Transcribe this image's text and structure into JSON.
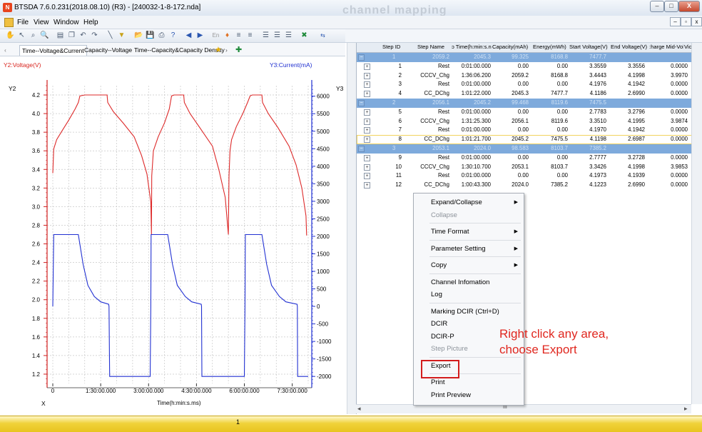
{
  "window": {
    "title": "BTSDA 7.6.0.231(2018.08.10) (R3) - [240032-1-8-172.nda]",
    "background_text": "channel mapping",
    "app_icon": "N"
  },
  "window_controls": {
    "minimize": "–",
    "maximize": "□",
    "close": "X"
  },
  "mdi_controls": {
    "minimize": "–",
    "restore": "▫",
    "close": "x"
  },
  "menu": [
    "File",
    "View",
    "Window",
    "Help"
  ],
  "toolbar_icons": [
    "hand-icon",
    "pointer-icon",
    "zoom-region-icon",
    "zoom-icon",
    "table-icon",
    "copy-icon",
    "undo-icon",
    "redo-icon",
    "line-icon",
    "filter-icon",
    "open-icon",
    "save-icon",
    "print-icon",
    "help-icon",
    "prev-icon",
    "next-icon",
    "en-icon",
    "pin-icon",
    "grid-icon",
    "grid2-icon",
    "list-icon",
    "list2-icon",
    "list3-icon",
    "excel-icon",
    "export-icon"
  ],
  "tabs": [
    "Time--Voltage&Current",
    "Capacity--Voltage",
    "Time--Capacity&Capacity Density"
  ],
  "chart": {
    "y2_legend": "Y2:Voltage(V)",
    "y3_legend": "Y3:Current(mA)",
    "y2_axis_title": "Y2",
    "y3_axis_title": "Y3",
    "x_axis_title": "X",
    "x_label": "Time(h:min:s.ms)",
    "y2_ticks": [
      "4.2",
      "4.0",
      "3.8",
      "3.6",
      "3.4",
      "3.2",
      "3.0",
      "2.8",
      "2.6",
      "2.4",
      "2.2",
      "2.0",
      "1.8",
      "1.6",
      "1.4",
      "1.2"
    ],
    "y3_ticks": [
      "6000",
      "5500",
      "5000",
      "4500",
      "4000",
      "3500",
      "3000",
      "2500",
      "2000",
      "1500",
      "1000",
      "500",
      "0",
      "-500",
      "-1000",
      "-1500",
      "-2000"
    ],
    "x_ticks": [
      "0",
      "1:30:00.000",
      "3:00:00.000",
      "4:30:00.000",
      "6:00:00.000",
      "7:30:00.000"
    ]
  },
  "chart_data": {
    "type": "line",
    "title": "",
    "xlabel": "Time(h:min:s.ms)",
    "x_unit_note": "hours",
    "xlim": [
      0,
      8
    ],
    "series": [
      {
        "name": "Y2:Voltage(V)",
        "axis": "left",
        "color": "#dd2a2a",
        "ylim": [
          1.1,
          4.3
        ],
        "x": [
          0,
          0.03,
          0.12,
          0.3,
          0.5,
          0.7,
          0.8,
          0.85,
          1.0,
          1.55,
          1.7,
          1.72,
          1.9,
          2.2,
          2.55,
          2.78,
          2.95,
          3.07,
          3.09,
          3.1,
          3.15,
          3.3,
          3.5,
          3.65,
          3.72,
          3.8,
          4.0,
          4.1,
          4.12,
          4.3,
          4.6,
          5.0,
          5.2,
          5.4,
          5.5,
          5.52,
          5.55,
          5.6,
          5.75,
          5.95,
          6.1,
          6.18,
          6.25,
          6.45,
          6.55,
          6.57,
          6.75,
          7.05,
          7.4,
          7.62,
          7.8,
          7.93,
          7.95
        ],
        "values": [
          3.36,
          3.62,
          3.72,
          3.82,
          3.93,
          4.05,
          4.12,
          4.19,
          4.2,
          4.2,
          4.2,
          4.12,
          4.02,
          3.9,
          3.75,
          3.55,
          3.35,
          3.05,
          2.7,
          3.33,
          3.6,
          3.75,
          3.9,
          4.05,
          4.19,
          4.2,
          4.2,
          4.2,
          4.12,
          4.0,
          3.85,
          3.65,
          3.4,
          3.1,
          2.7,
          3.33,
          3.6,
          3.72,
          3.86,
          4.0,
          4.12,
          4.19,
          4.2,
          4.2,
          4.2,
          4.12,
          4.0,
          3.85,
          3.65,
          3.45,
          3.2,
          2.9,
          2.69
        ]
      },
      {
        "name": "Y3:Current(mA)",
        "axis": "right",
        "color": "#2231d2",
        "ylim": [
          -2200,
          6300
        ],
        "x": [
          0,
          0.03,
          0.8,
          0.95,
          1.1,
          1.3,
          1.5,
          1.75,
          1.76,
          1.78,
          3.05,
          3.07,
          3.08,
          3.15,
          3.6,
          3.75,
          3.9,
          4.15,
          4.35,
          4.65,
          4.66,
          4.67,
          6.0,
          6.02,
          6.03,
          6.1,
          6.55,
          6.7,
          6.85,
          7.1,
          7.3,
          7.65,
          7.66,
          7.67,
          8.0
        ],
        "values": [
          0,
          2050,
          2050,
          1200,
          600,
          280,
          130,
          60,
          0,
          -2000,
          -2000,
          0,
          2050,
          2050,
          2050,
          1200,
          600,
          280,
          130,
          60,
          0,
          -2000,
          -2000,
          0,
          2050,
          2050,
          2050,
          1200,
          600,
          280,
          130,
          60,
          0,
          -2000,
          -2000
        ]
      }
    ],
    "grid": true
  },
  "steps_table": {
    "columns": [
      "Step ID",
      "Step Name",
      "Step Time(h:min:s.ms)",
      "Capacity(mAh)",
      "Energy(mWh)",
      "Start Voltage(V)",
      "End Voltage(V)",
      "Charge Mid-Vol(V)",
      "Discharge Mid-Vol(V)"
    ],
    "column_display": [
      "Step ID",
      "Step Name",
      "ɔ Time(h:min:s.n",
      "Capacity(mAh)",
      "Energy(mWh)",
      "Start Voltage(V)",
      "End Voltage(V)",
      ":harge Mid-Vol(",
      "Vichar"
    ],
    "rows": [
      {
        "type": "group",
        "expander": "−",
        "cells": [
          "1",
          "2059.2",
          "2045.3",
          "99.325",
          "8168.8",
          "7477.7",
          "",
          ""
        ]
      },
      {
        "type": "step",
        "expander": "+",
        "cells": [
          "1",
          "Rest",
          "0:01:00.000",
          "0.00",
          "0.00",
          "3.3559",
          "3.3556",
          "0.0000"
        ]
      },
      {
        "type": "step",
        "expander": "+",
        "cells": [
          "2",
          "CCCV_Chg",
          "1:36:06.200",
          "2059.2",
          "8168.8",
          "3.4443",
          "4.1998",
          "3.9970"
        ]
      },
      {
        "type": "step",
        "expander": "+",
        "cells": [
          "3",
          "Rest",
          "0:01:00.000",
          "0.00",
          "0.00",
          "4.1976",
          "4.1942",
          "0.0000"
        ]
      },
      {
        "type": "step",
        "expander": "+",
        "cells": [
          "4",
          "CC_DChg",
          "1:01:22.000",
          "2045.3",
          "7477.7",
          "4.1186",
          "2.6990",
          "0.0000"
        ]
      },
      {
        "type": "group",
        "expander": "−",
        "cells": [
          "2",
          "2056.1",
          "2045.2",
          "99.468",
          "8119.6",
          "7475.5",
          "",
          ""
        ]
      },
      {
        "type": "step",
        "expander": "+",
        "cells": [
          "5",
          "Rest",
          "0:01:00.000",
          "0.00",
          "0.00",
          "2.7783",
          "3.2796",
          "0.0000"
        ]
      },
      {
        "type": "step",
        "expander": "+",
        "cells": [
          "6",
          "CCCV_Chg",
          "1:31:25.300",
          "2056.1",
          "8119.6",
          "3.3510",
          "4.1995",
          "3.9874"
        ]
      },
      {
        "type": "step",
        "expander": "+",
        "cells": [
          "7",
          "Rest",
          "0:01:00.000",
          "0.00",
          "0.00",
          "4.1970",
          "4.1942",
          "0.0000"
        ]
      },
      {
        "type": "step",
        "expander": "+",
        "highlight": true,
        "cells": [
          "8",
          "CC_DChg",
          "1:01:21.700",
          "2045.2",
          "7475.5",
          "4.1198",
          "2.6987",
          "0.0000"
        ]
      },
      {
        "type": "group",
        "expander": "−",
        "cells": [
          "3",
          "2053.1",
          "2024.0",
          "98.583",
          "8103.7",
          "7385.2",
          "",
          ""
        ]
      },
      {
        "type": "step",
        "expander": "+",
        "cells": [
          "9",
          "Rest",
          "0:01:00.000",
          "0.00",
          "0.00",
          "2.7777",
          "3.2728",
          "0.0000"
        ]
      },
      {
        "type": "step",
        "expander": "+",
        "cells": [
          "10",
          "CCCV_Chg",
          "1:30:10.700",
          "2053.1",
          "8103.7",
          "3.3426",
          "4.1998",
          "3.9853"
        ]
      },
      {
        "type": "step",
        "expander": "+",
        "cells": [
          "11",
          "Rest",
          "0:01:00.000",
          "0.00",
          "0.00",
          "4.1973",
          "4.1939",
          "0.0000"
        ]
      },
      {
        "type": "step",
        "expander": "+",
        "cells": [
          "12",
          "CC_DChg",
          "1:00:43.300",
          "2024.0",
          "7385.2",
          "4.1223",
          "2.6990",
          "0.0000"
        ]
      }
    ]
  },
  "context_menu": {
    "items": [
      {
        "label": "Expand/Collapse",
        "submenu": true,
        "disabled": false
      },
      {
        "label": "Collapse",
        "submenu": false,
        "disabled": true
      },
      {
        "sep": true
      },
      {
        "label": "Time Format",
        "submenu": true,
        "disabled": false
      },
      {
        "sep": true
      },
      {
        "label": "Parameter Setting",
        "submenu": true,
        "disabled": false
      },
      {
        "sep": true
      },
      {
        "label": "Copy",
        "submenu": true,
        "disabled": false
      },
      {
        "sep": true
      },
      {
        "label": "Channel Infomation",
        "submenu": false,
        "disabled": false
      },
      {
        "label": "Log",
        "submenu": false,
        "disabled": false
      },
      {
        "sep": true
      },
      {
        "label": "Marking DCIR (Ctrl+D)",
        "submenu": false,
        "disabled": false
      },
      {
        "label": "DCIR",
        "submenu": false,
        "disabled": false
      },
      {
        "label": "DCIR-P",
        "submenu": false,
        "disabled": false
      },
      {
        "label": "Step Picture",
        "submenu": false,
        "disabled": true
      },
      {
        "sep": true
      },
      {
        "label": "Export",
        "submenu": false,
        "disabled": false,
        "highlighted": true
      },
      {
        "sep": true
      },
      {
        "label": "Print",
        "submenu": false,
        "disabled": false
      },
      {
        "label": "Print Preview",
        "submenu": false,
        "disabled": false
      }
    ],
    "submenu_arrow": "▶"
  },
  "annotation": {
    "line1": "Right click any area,",
    "line2": "choose Export",
    "color": "#e0271f"
  },
  "scrollbar": {
    "thumb_label": "III",
    "left": "◂",
    "right": "▸"
  },
  "status": {
    "marker": "1"
  }
}
